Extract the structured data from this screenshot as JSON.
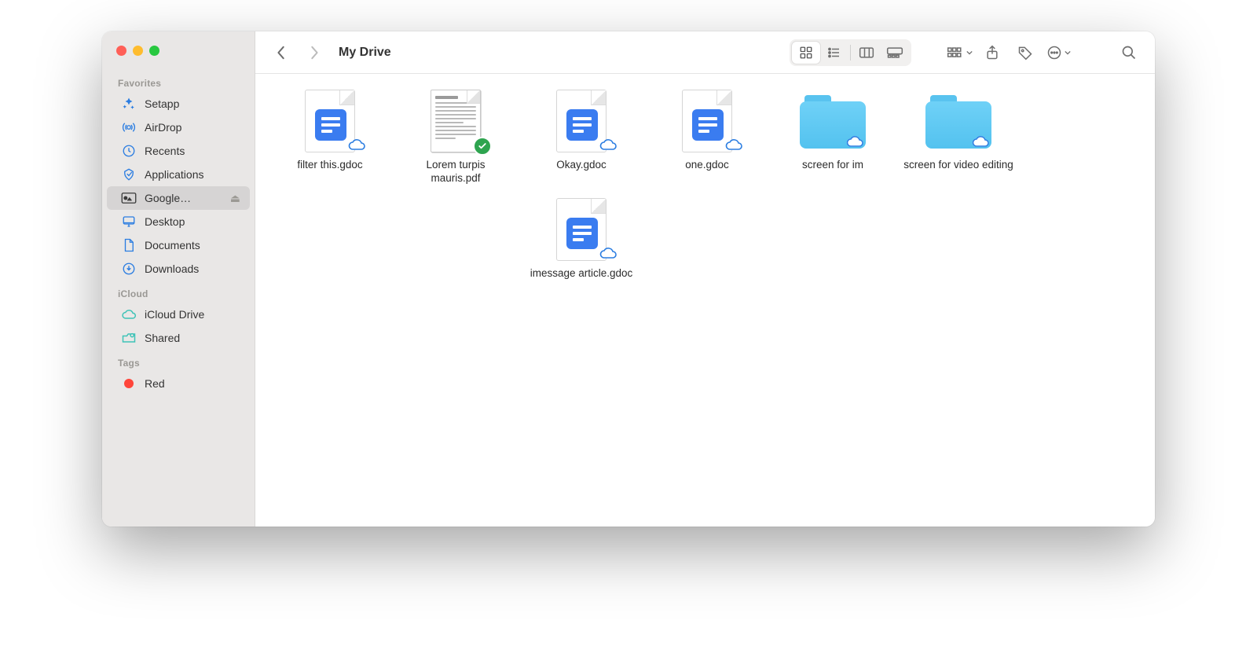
{
  "window": {
    "title": "My Drive"
  },
  "sidebar": {
    "sections": [
      {
        "label": "Favorites",
        "items": [
          {
            "icon": "setapp-icon",
            "label": "Setapp"
          },
          {
            "icon": "airdrop-icon",
            "label": "AirDrop"
          },
          {
            "icon": "clock-icon",
            "label": "Recents"
          },
          {
            "icon": "apps-icon",
            "label": "Applications"
          },
          {
            "icon": "drive-icon",
            "label": "Google…",
            "selected": true,
            "ejectable": true
          },
          {
            "icon": "desktop-icon",
            "label": "Desktop"
          },
          {
            "icon": "doc-icon",
            "label": "Documents"
          },
          {
            "icon": "download-icon",
            "label": "Downloads"
          }
        ]
      },
      {
        "label": "iCloud",
        "items": [
          {
            "icon": "icloud-icon",
            "label": "iCloud Drive"
          },
          {
            "icon": "shared-icon",
            "label": "Shared"
          }
        ]
      },
      {
        "label": "Tags",
        "items": [
          {
            "icon": "tag-dot",
            "label": "Red",
            "color": "#ff453a"
          }
        ]
      }
    ]
  },
  "toolbar": {
    "view_mode": "icons"
  },
  "items": [
    {
      "kind": "gdoc",
      "name": "filter this.gdoc",
      "badge": "cloud"
    },
    {
      "kind": "pdf",
      "name": "Lorem turpis mauris.pdf",
      "badge": "synced"
    },
    {
      "kind": "gdoc",
      "name": "Okay.gdoc",
      "badge": "cloud"
    },
    {
      "kind": "gdoc",
      "name": "one.gdoc",
      "badge": "cloud"
    },
    {
      "kind": "folder",
      "name": "screen for im",
      "badge": "cloud"
    },
    {
      "kind": "folder",
      "name": "screen for video editing",
      "badge": "cloud"
    },
    {
      "kind": "gdoc",
      "name": "imessage article.gdoc",
      "badge": "cloud",
      "column": 2
    }
  ]
}
